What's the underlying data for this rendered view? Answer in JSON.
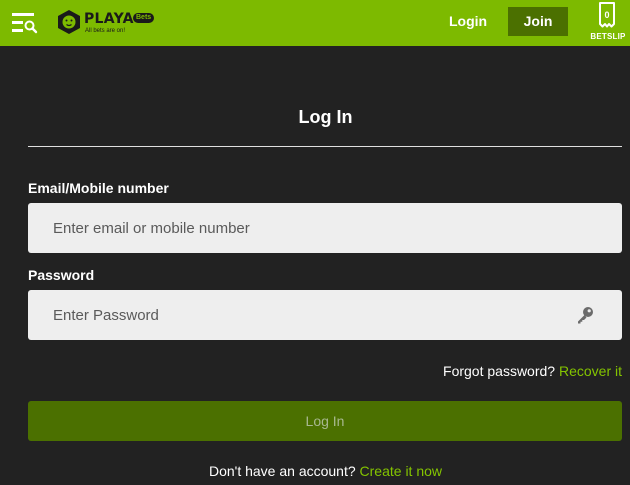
{
  "header": {
    "logo_word": "PLAYA",
    "logo_pill": "Bets",
    "logo_tagline": "All bets are on!",
    "login_label": "Login",
    "join_label": "Join",
    "betslip_count": "0",
    "betslip_label": "BETSLIP"
  },
  "form": {
    "title": "Log In",
    "email_label": "Email/Mobile number",
    "email_placeholder": "Enter email or mobile number",
    "email_value": "",
    "password_label": "Password",
    "password_placeholder": "Enter Password",
    "password_value": "",
    "forgot_text": "Forgot password?",
    "recover_link": "Recover it",
    "submit_label": "Log In",
    "no_account_text": "Don't have an account?",
    "create_link": "Create it now"
  },
  "colors": {
    "brand_green": "#7dba00",
    "dark_green": "#4b7000",
    "link_green": "#84c400",
    "background": "#222222"
  },
  "icons": [
    "menu-search-icon",
    "lion-logo-icon",
    "betslip-ticket-icon",
    "key-icon"
  ]
}
